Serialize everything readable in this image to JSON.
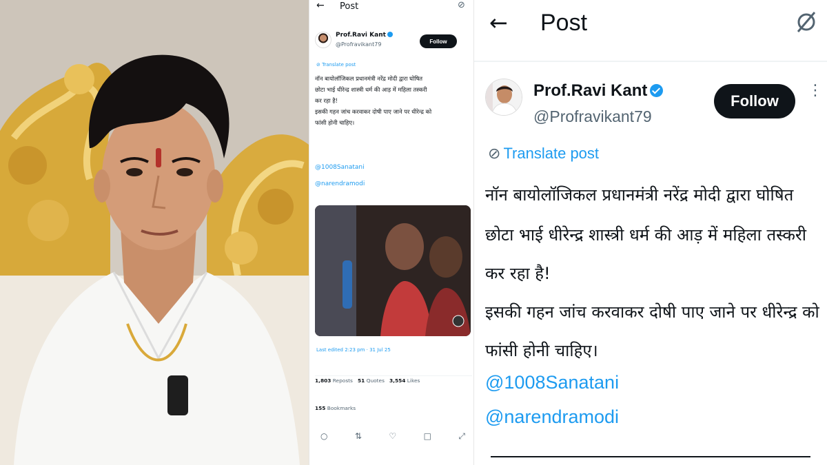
{
  "phone": {
    "back_icon": "arrow-left-icon",
    "title": "Post",
    "author_name": "Prof.Ravi Kant",
    "author_handle": "@Profravikant79",
    "follow_label": "Follow",
    "translate_label": "Translate post",
    "body_lines": [
      "नॉन बायोलॉजिकल प्रधानमंत्री नरेंद्र मोदी द्वारा घोषित",
      "छोटा भाई धीरेन्द्र शास्त्री धर्म की आड़ में महिला तस्करी",
      "कर रहा है!",
      "इसकी गहन जांच करवाकर दोषी पाए जाने पर धीरेन्द्र को",
      "फांसी होनी चाहिए।"
    ],
    "mentions": [
      "@1008Sanatani",
      "@narendramodi"
    ],
    "last_edited": "Last edited 2:23 pm · 31 Jul 25",
    "reposts_count": "1,803",
    "reposts_label": "Reposts",
    "quotes_count": "51",
    "quotes_label": "Quotes",
    "likes_count": "3,554",
    "likes_label": "Likes",
    "bookmarks_count": "155",
    "bookmarks_label": "Bookmarks"
  },
  "zoom": {
    "title": "Post",
    "author_name": "Prof.Ravi Kant",
    "author_handle": "@Profravikant79",
    "follow_label": "Follow",
    "translate_label": "Translate post",
    "body_lines": [
      "नॉन बायोलॉजिकल प्रधानमंत्री नरेंद्र मोदी द्वारा घोषित",
      "छोटा भाई धीरेन्द्र शास्त्री धर्म की आड़ में महिला तस्करी",
      "कर रहा है!",
      "इसकी गहन जांच करवाकर दोषी पाए जाने पर धीरेन्द्र को",
      "फांसी होनी चाहिए।"
    ],
    "mentions": [
      "@1008Sanatani",
      "@narendramodi"
    ]
  },
  "colors": {
    "link": "#1d9bf0",
    "text": "#0f1419",
    "muted": "#536471",
    "button": "#0f1419"
  }
}
